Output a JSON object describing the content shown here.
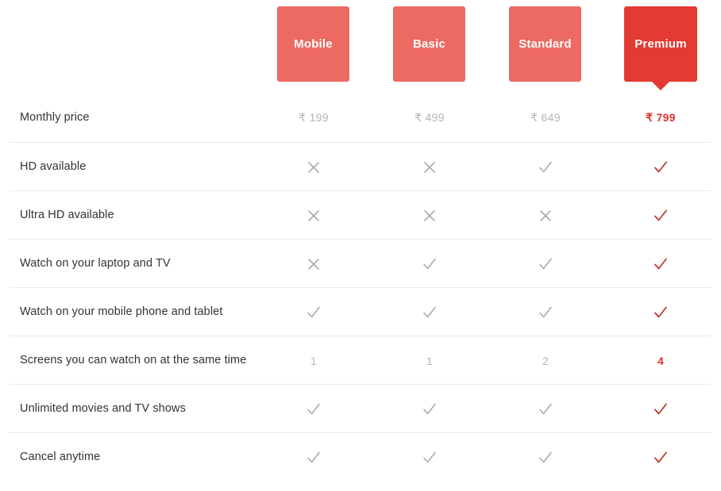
{
  "plans": [
    {
      "name": "Mobile",
      "featured": false,
      "color": "#ec6a62"
    },
    {
      "name": "Basic",
      "featured": false,
      "color": "#ec6a62"
    },
    {
      "name": "Standard",
      "featured": false,
      "color": "#ec6a62"
    },
    {
      "name": "Premium",
      "featured": true,
      "color": "#e33a31"
    }
  ],
  "colors": {
    "tab_default": "#ec6a62",
    "tab_featured": "#e33a31",
    "mark_muted": "#aaaaaa",
    "mark_featured": "#c0392b",
    "value_muted": "#b4b4b4",
    "value_featured": "#d9352c",
    "divider": "#e8e8e8",
    "label_text": "#333333"
  },
  "rows": [
    {
      "label": "Monthly price",
      "type": "text",
      "cells": [
        {
          "kind": "text",
          "text": "₹ 199",
          "highlight": false
        },
        {
          "kind": "text",
          "text": "₹ 499",
          "highlight": false
        },
        {
          "kind": "text",
          "text": "₹ 649",
          "highlight": false
        },
        {
          "kind": "text",
          "text": "₹ 799",
          "highlight": true
        }
      ]
    },
    {
      "label": "HD available",
      "type": "mark",
      "cells": [
        {
          "kind": "cross",
          "icon": "cross-icon"
        },
        {
          "kind": "cross",
          "icon": "cross-icon"
        },
        {
          "kind": "check",
          "icon": "check-icon"
        },
        {
          "kind": "check",
          "icon": "check-icon"
        }
      ]
    },
    {
      "label": "Ultra HD available",
      "type": "mark",
      "cells": [
        {
          "kind": "cross",
          "icon": "cross-icon"
        },
        {
          "kind": "cross",
          "icon": "cross-icon"
        },
        {
          "kind": "cross",
          "icon": "cross-icon"
        },
        {
          "kind": "check",
          "icon": "check-icon"
        }
      ]
    },
    {
      "label": "Watch on your laptop and TV",
      "type": "mark",
      "cells": [
        {
          "kind": "cross",
          "icon": "cross-icon"
        },
        {
          "kind": "check",
          "icon": "check-icon"
        },
        {
          "kind": "check",
          "icon": "check-icon"
        },
        {
          "kind": "check",
          "icon": "check-icon"
        }
      ]
    },
    {
      "label": "Watch on your mobile phone and tablet",
      "type": "mark",
      "cells": [
        {
          "kind": "check",
          "icon": "check-icon"
        },
        {
          "kind": "check",
          "icon": "check-icon"
        },
        {
          "kind": "check",
          "icon": "check-icon"
        },
        {
          "kind": "check",
          "icon": "check-icon"
        }
      ]
    },
    {
      "label": "Screens you can watch on at the same time",
      "type": "text",
      "cells": [
        {
          "kind": "text",
          "text": "1",
          "highlight": false
        },
        {
          "kind": "text",
          "text": "1",
          "highlight": false
        },
        {
          "kind": "text",
          "text": "2",
          "highlight": false
        },
        {
          "kind": "text",
          "text": "4",
          "highlight": true
        }
      ]
    },
    {
      "label": "Unlimited movies and TV shows",
      "type": "mark",
      "cells": [
        {
          "kind": "check",
          "icon": "check-icon"
        },
        {
          "kind": "check",
          "icon": "check-icon"
        },
        {
          "kind": "check",
          "icon": "check-icon"
        },
        {
          "kind": "check",
          "icon": "check-icon"
        }
      ]
    },
    {
      "label": "Cancel anytime",
      "type": "mark",
      "cells": [
        {
          "kind": "check",
          "icon": "check-icon"
        },
        {
          "kind": "check",
          "icon": "check-icon"
        },
        {
          "kind": "check",
          "icon": "check-icon"
        },
        {
          "kind": "check",
          "icon": "check-icon"
        }
      ]
    }
  ]
}
